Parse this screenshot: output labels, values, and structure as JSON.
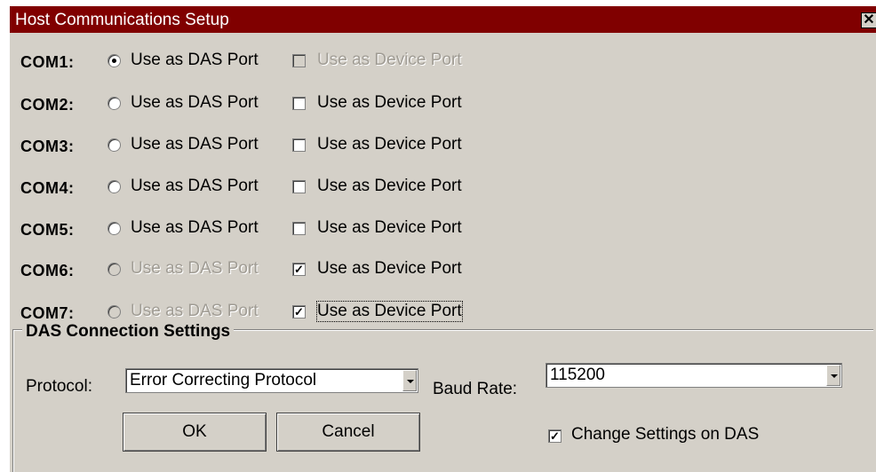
{
  "window": {
    "title": "Host Communications Setup",
    "close_glyph": "✕"
  },
  "ports": [
    {
      "name": "COM1:",
      "das_label": "Use as DAS Port",
      "das_selected": true,
      "das_enabled": true,
      "device_label": "Use as Device Port",
      "device_checked": false,
      "device_enabled": false
    },
    {
      "name": "COM2:",
      "das_label": "Use as DAS Port",
      "das_selected": false,
      "das_enabled": true,
      "device_label": "Use as Device Port",
      "device_checked": false,
      "device_enabled": true
    },
    {
      "name": "COM3:",
      "das_label": "Use as DAS Port",
      "das_selected": false,
      "das_enabled": true,
      "device_label": "Use as Device Port",
      "device_checked": false,
      "device_enabled": true
    },
    {
      "name": "COM4:",
      "das_label": "Use as DAS Port",
      "das_selected": false,
      "das_enabled": true,
      "device_label": "Use as Device Port",
      "device_checked": false,
      "device_enabled": true
    },
    {
      "name": "COM5:",
      "das_label": "Use as DAS Port",
      "das_selected": false,
      "das_enabled": true,
      "device_label": "Use as Device Port",
      "device_checked": false,
      "device_enabled": true
    },
    {
      "name": "COM6:",
      "das_label": "Use as DAS Port",
      "das_selected": false,
      "das_enabled": false,
      "device_label": "Use as Device Port",
      "device_checked": true,
      "device_enabled": true
    },
    {
      "name": "COM7:",
      "das_label": "Use as DAS Port",
      "das_selected": false,
      "das_enabled": false,
      "device_label": "Use as Device Port",
      "device_checked": true,
      "device_enabled": true
    }
  ],
  "das_settings": {
    "group_title": "DAS Connection Settings",
    "protocol_label": "Protocol:",
    "protocol_value": "Error Correcting Protocol",
    "baud_label": "Baud Rate:",
    "baud_value": "115200",
    "change_settings_label": "Change Settings on DAS",
    "change_settings_checked": true
  },
  "buttons": {
    "ok": "OK",
    "cancel": "Cancel"
  },
  "colors": {
    "title_bar": "#800000",
    "face": "#d4d0c8"
  }
}
